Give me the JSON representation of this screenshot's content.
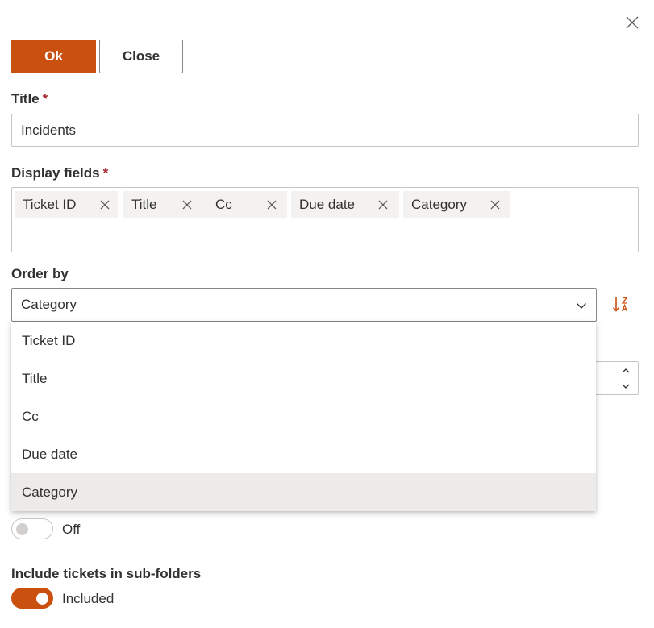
{
  "dialog": {
    "close_icon": "close-icon"
  },
  "toolbar": {
    "ok_label": "Ok",
    "close_label": "Close"
  },
  "title_field": {
    "label": "Title",
    "required_mark": "*",
    "value": "Incidents"
  },
  "display_fields": {
    "label": "Display fields",
    "required_mark": "*",
    "tags": [
      "Ticket ID",
      "Title",
      "Cc",
      "Due date",
      "Category"
    ]
  },
  "order_by": {
    "label": "Order by",
    "selected": "Category",
    "sort_icon": "sort-descending-z-a-icon",
    "options": [
      "Ticket ID",
      "Title",
      "Cc",
      "Due date",
      "Category"
    ],
    "highlighted_option": "Category"
  },
  "spin_button": {
    "up_icon": "chevron-up-icon",
    "down_icon": "chevron-down-icon"
  },
  "toggle_one": {
    "state_label": "Off",
    "on": false
  },
  "subfolders": {
    "label": "Include tickets in sub-folders",
    "state_label": "Included",
    "on": true
  },
  "colors": {
    "accent": "#ca5010",
    "required": "#a4262c",
    "text": "#323130",
    "border": "#c8c6c4",
    "selected_option_bg": "#edebe9"
  }
}
